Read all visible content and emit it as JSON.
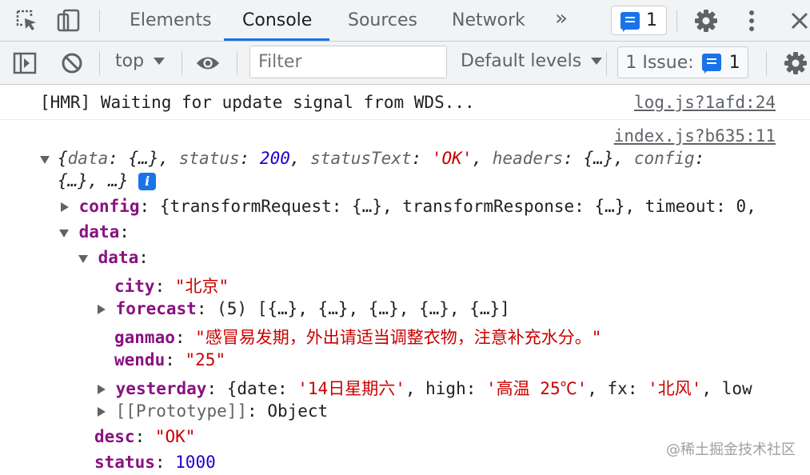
{
  "tabs": {
    "items": [
      "Elements",
      "Console",
      "Sources",
      "Network"
    ],
    "active": "Console",
    "more": "»",
    "messages_count": "1"
  },
  "toolbar": {
    "context": "top",
    "filter_placeholder": "Filter",
    "levels": "Default levels",
    "issue_label": "1 Issue:",
    "issue_count": "1"
  },
  "console": {
    "hmr_text": "[HMR] Waiting for update signal from WDS...",
    "hmr_source": "log.js?1afd:24",
    "obj_source": "index.js?b635:11",
    "summary": {
      "k1": "data",
      "v1": "{…}",
      "k2": "status",
      "v2": "200",
      "k3": "statusText",
      "v3": "'OK'",
      "k4": "headers",
      "v4": "{…}",
      "k5": "config",
      "v5": "{…}",
      "tail": "…}"
    },
    "config_line": {
      "key": "config",
      "value": "{transformRequest: {…}, transformResponse: {…}, timeout: 0,"
    },
    "data_key": "data",
    "inner_data_key": "data",
    "city": {
      "key": "city",
      "value": "\"北京\""
    },
    "forecast": {
      "key": "forecast",
      "count": "(5)",
      "value": "[{…}, {…}, {…}, {…}, {…}]"
    },
    "ganmao": {
      "key": "ganmao",
      "value": "\"感冒易发期，外出请适当调整衣物，注意补充水分。\""
    },
    "wendu": {
      "key": "wendu",
      "value": "\"25\""
    },
    "yesterday": {
      "key": "yesterday",
      "k_date": "date",
      "v_date": "'14日星期六'",
      "k_high": "high",
      "v_high": "'高温 25℃'",
      "k_fx": "fx",
      "v_fx": "'北风'",
      "k_low": "low"
    },
    "prototype": {
      "key": "[[Prototype]]",
      "value": "Object"
    },
    "desc": {
      "key": "desc",
      "value": "\"OK\""
    },
    "status": {
      "key": "status",
      "value": "1000"
    }
  },
  "watermark": "@稀土掘金技术社区",
  "colors": {
    "accent": "#1a73e8",
    "key": "#881280",
    "string": "#c80000",
    "number": "#1c00cf"
  }
}
